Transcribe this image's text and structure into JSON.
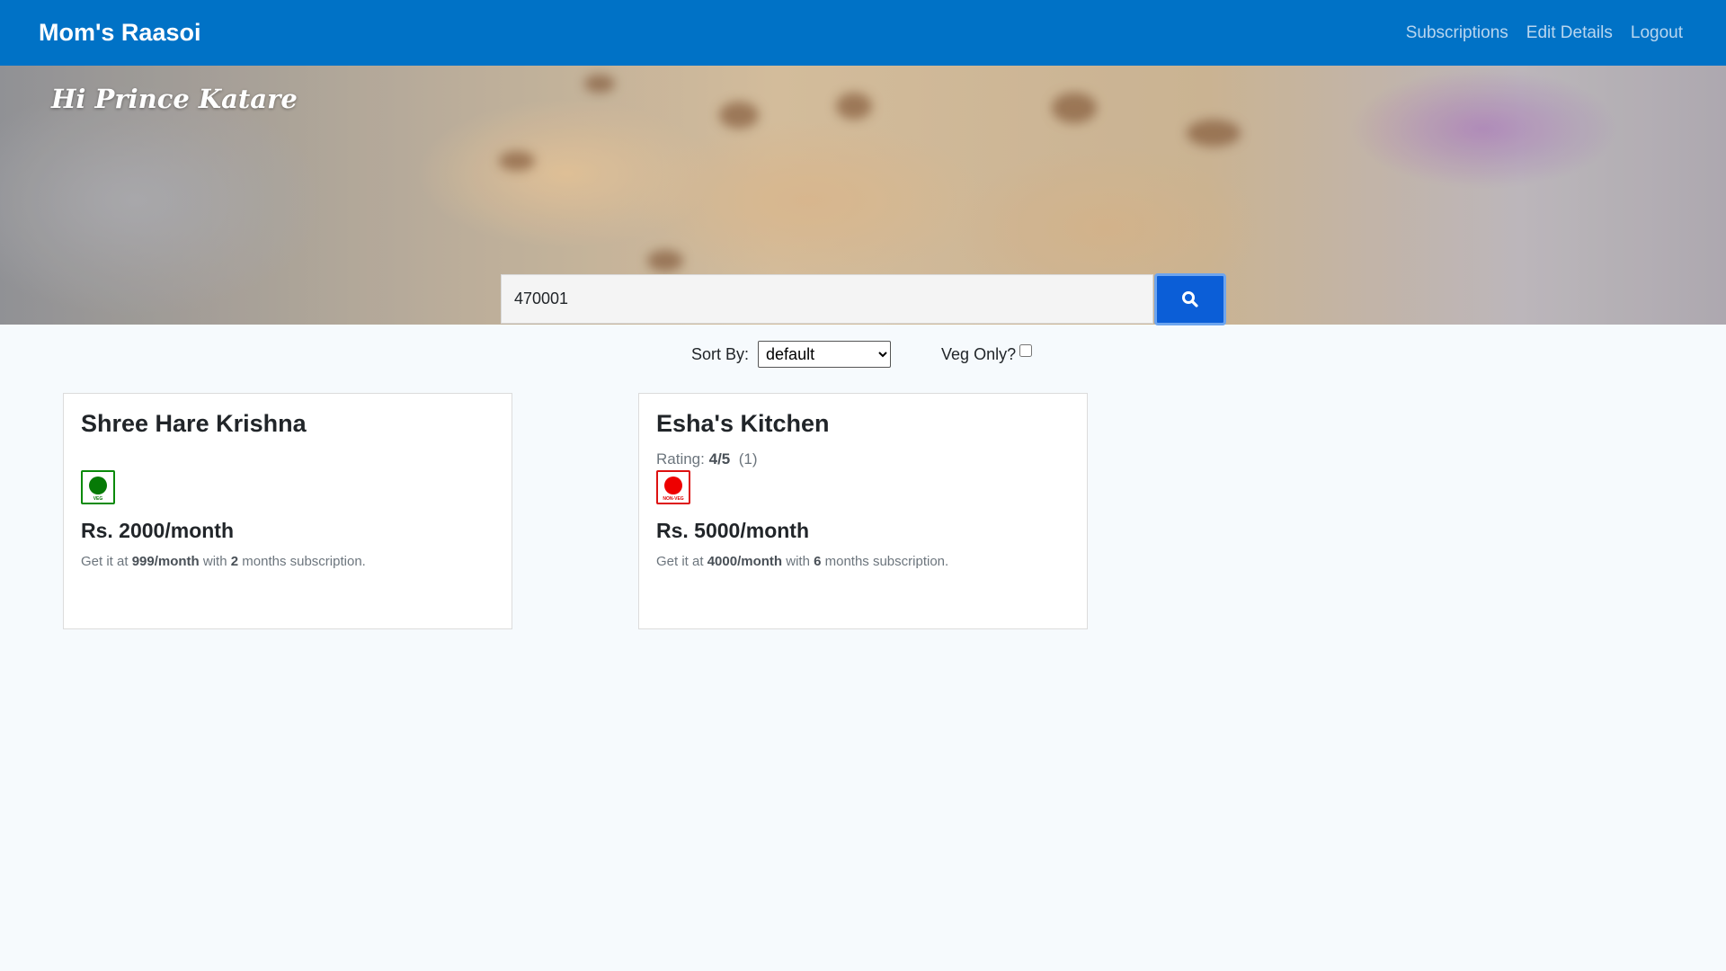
{
  "navbar": {
    "brand": "Mom's Raasoi",
    "links": [
      "Subscriptions",
      "Edit Details",
      "Logout"
    ]
  },
  "hero": {
    "greeting": "Hi Prince Katare"
  },
  "search": {
    "value": "470001",
    "button_icon": "search-icon"
  },
  "filters": {
    "sort_label": "Sort By:",
    "sort_selected": "default",
    "veg_label": "Veg Only?",
    "veg_checked": false
  },
  "kitchens": [
    {
      "name": "Shree Hare Krishna",
      "rating_label": "",
      "rating_value": "",
      "rating_count": "",
      "food_type": "veg",
      "food_mark_text": "VEG",
      "price": "Rs. 2000/month",
      "offer_prefix": "Get it at",
      "offer_price": "999/month",
      "offer_with": "with",
      "offer_months": "2",
      "offer_suffix": "months subscription."
    },
    {
      "name": "Esha's Kitchen",
      "rating_label": "Rating:",
      "rating_value": "4/5",
      "rating_count": "(1)",
      "food_type": "non-veg",
      "food_mark_text": "NON-VEG",
      "price": "Rs. 5000/month",
      "offer_prefix": "Get it at",
      "offer_price": "4000/month",
      "offer_with": "with",
      "offer_months": "6",
      "offer_suffix": "months subscription."
    }
  ],
  "colors": {
    "navbar": "#0072c6",
    "primary_button": "#0b5ed7",
    "veg_green": "#067a06",
    "nonveg_red": "#e00000",
    "page_background": "#f6fafd"
  }
}
